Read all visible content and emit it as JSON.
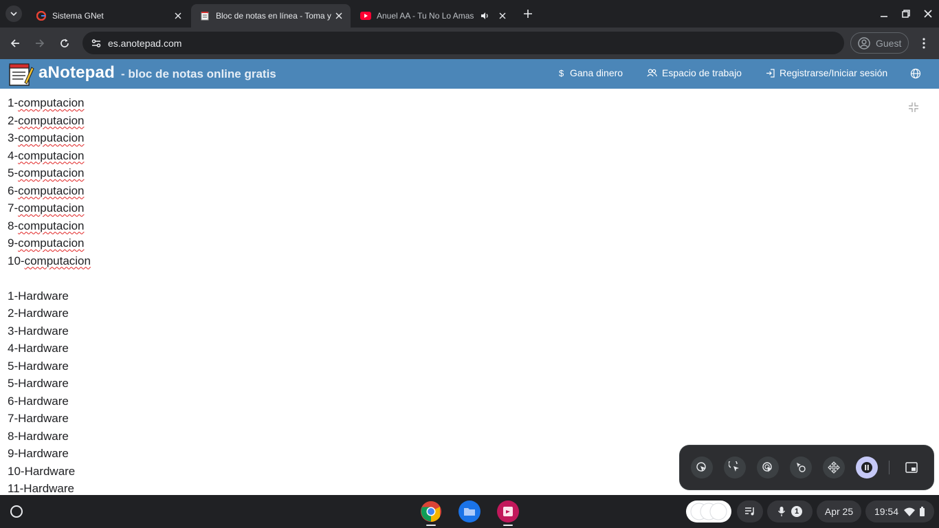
{
  "browser": {
    "tabs": [
      {
        "title": "Sistema GNet",
        "favicon": "google-g-icon",
        "active": false
      },
      {
        "title": "Bloc de notas en línea - Toma y",
        "favicon": "notepad-icon",
        "active": true
      },
      {
        "title": "Anuel AA - Tu No Lo Amas",
        "favicon": "youtube-icon",
        "active": false,
        "audio": true
      }
    ],
    "url": "es.anotepad.com",
    "profile_label": "Guest"
  },
  "site": {
    "brand": "aNotepad",
    "tagline": "- bloc de notas online gratis",
    "nav": [
      {
        "label": "Gana dinero",
        "icon": "dollar-icon"
      },
      {
        "label": "Espacio de trabajo",
        "icon": "users-icon"
      },
      {
        "label": "Registrarse/Iniciar sesión",
        "icon": "login-icon"
      }
    ],
    "language_icon": "globe-icon"
  },
  "note": {
    "lines": [
      "1-computacion",
      "2-computacion",
      "3-computacion",
      "4-computacion",
      "5-computacion",
      "6-computacion",
      "7-computacion",
      "8-computacion",
      "9-computacion",
      "10-computacion",
      "",
      "1-Hardware",
      "2-Hardware",
      "3-Hardware",
      "4-Hardware",
      "5-Hardware",
      "5-Hardware",
      "6-Hardware",
      "7-Hardware",
      "8-Hardware",
      "9-Hardware",
      "10-Hardware",
      "11-Hardware"
    ],
    "misspelled_word": "computacion"
  },
  "float_panel": {
    "buttons": [
      "click-icon",
      "double-click-icon",
      "right-click-icon",
      "drag-icon",
      "move-icon",
      "pause-icon",
      "picture-in-picture-icon"
    ]
  },
  "shelf": {
    "apps": [
      "chrome-icon",
      "files-icon",
      "screencast-icon"
    ],
    "notification_count": "1",
    "date": "Apr 25",
    "time": "19:54"
  },
  "colors": {
    "header_blue": "#4b86b8",
    "spell_error": "#e02020",
    "chrome_dark": "#202124"
  }
}
